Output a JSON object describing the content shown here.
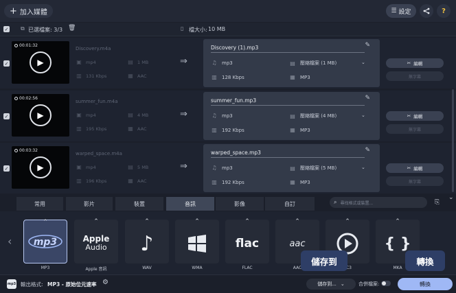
{
  "toolbar": {
    "add_label": "加入媒體",
    "settings_label": "設定"
  },
  "statusbar": {
    "selected": "已選檔案: 3/3",
    "size_label": "檔大小:",
    "size_value": "10 MB"
  },
  "files": [
    {
      "time": "00:01:32",
      "source": "Discovery.m4a",
      "src_container": "mp4",
      "src_size": "1 MB",
      "src_bitrate": "131 Kbps",
      "src_codec": "AAC",
      "output": "Discovery (1).mp3",
      "out_format": "mp3",
      "out_quality": "壓縮檔案 (1 MB)",
      "out_bitrate": "128 Kbps",
      "out_codec": "MP3"
    },
    {
      "time": "00:02:56",
      "source": "summer_fun.m4a",
      "src_container": "mp4",
      "src_size": "4 MB",
      "src_bitrate": "195 Kbps",
      "src_codec": "AAC",
      "output": "summer_fun.mp3",
      "out_format": "mp3",
      "out_quality": "壓縮檔案 (4 MB)",
      "out_bitrate": "192 Kbps",
      "out_codec": "MP3"
    },
    {
      "time": "00:03:32",
      "source": "warped_space.m4a",
      "src_container": "mp4",
      "src_size": "5 MB",
      "src_bitrate": "196 Kbps",
      "src_codec": "AAC",
      "output": "warped_space.mp3",
      "out_format": "mp3",
      "out_quality": "壓縮檔案 (5 MB)",
      "out_bitrate": "192 Kbps",
      "out_codec": "MP3"
    }
  ],
  "row_buttons": {
    "edit_label": "編輯",
    "sub_label": "無字幕"
  },
  "tabs": [
    "常用",
    "影片",
    "裝置",
    "音訊",
    "影像",
    "自訂"
  ],
  "active_tab": "音訊",
  "search_placeholder": "尋找格式或裝置...",
  "formats": [
    {
      "label": "MP3",
      "selected": true
    },
    {
      "label": "Apple 音訊",
      "logo_top": "Apple",
      "logo_bottom": "Audio"
    },
    {
      "label": "WAV"
    },
    {
      "label": "WMA"
    },
    {
      "label": "FLAC",
      "logo": "flac"
    },
    {
      "label": "AAC",
      "logo": "aac"
    },
    {
      "label": "AC3"
    },
    {
      "label": "MKA"
    }
  ],
  "footer": {
    "output_label": "輸出格式:",
    "output_value": "MP3 - 原始位元速率",
    "save_label": "儲存到...",
    "merge_label": "合併檔案:",
    "convert_label": "轉換"
  },
  "callouts": {
    "save": "儲存到",
    "convert": "轉換"
  },
  "colors": {
    "accent": "#9fb8f5",
    "background": "#1b1f2a",
    "card": "#333a49"
  }
}
